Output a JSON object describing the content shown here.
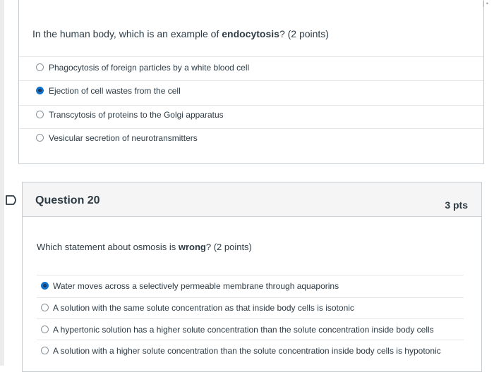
{
  "question19": {
    "prompt_prefix": "In the human body, which is an example of ",
    "prompt_bold": "endocytosis",
    "prompt_suffix": "? (2 points)",
    "answers": [
      {
        "label": "Phagocytosis of foreign particles by a white blood cell",
        "selected": false
      },
      {
        "label": "Ejection of cell wastes from the cell",
        "selected": true
      },
      {
        "label": "Transcytosis of proteins to the Golgi apparatus",
        "selected": false
      },
      {
        "label": "Vesicular secretion of neurotransmitters",
        "selected": false
      }
    ]
  },
  "question20": {
    "title": "Question 20",
    "points": "3 pts",
    "prompt_prefix": "Which statement about osmosis is ",
    "prompt_bold": "wrong",
    "prompt_suffix": "? (2 points)",
    "answers": [
      {
        "label": "Water moves across a selectively permeable membrane through aquaporins",
        "selected": true
      },
      {
        "label": "A solution with the same solute concentration as that inside body cells is isotonic",
        "selected": false
      },
      {
        "label": "A hypertonic solution has a higher solute concentration than the solute concentration inside body cells",
        "selected": false
      },
      {
        "label": "A solution with a higher solute concentration than the solute concentration inside body cells is hypotonic",
        "selected": false
      }
    ]
  },
  "colors": {
    "accent": "#0f74d1",
    "text": "#2d3b45",
    "border": "#c7cdd1",
    "header_bg": "#f5f5f5"
  },
  "icons": {
    "flag": "flag-outline-icon",
    "radio": "radio-icon"
  }
}
